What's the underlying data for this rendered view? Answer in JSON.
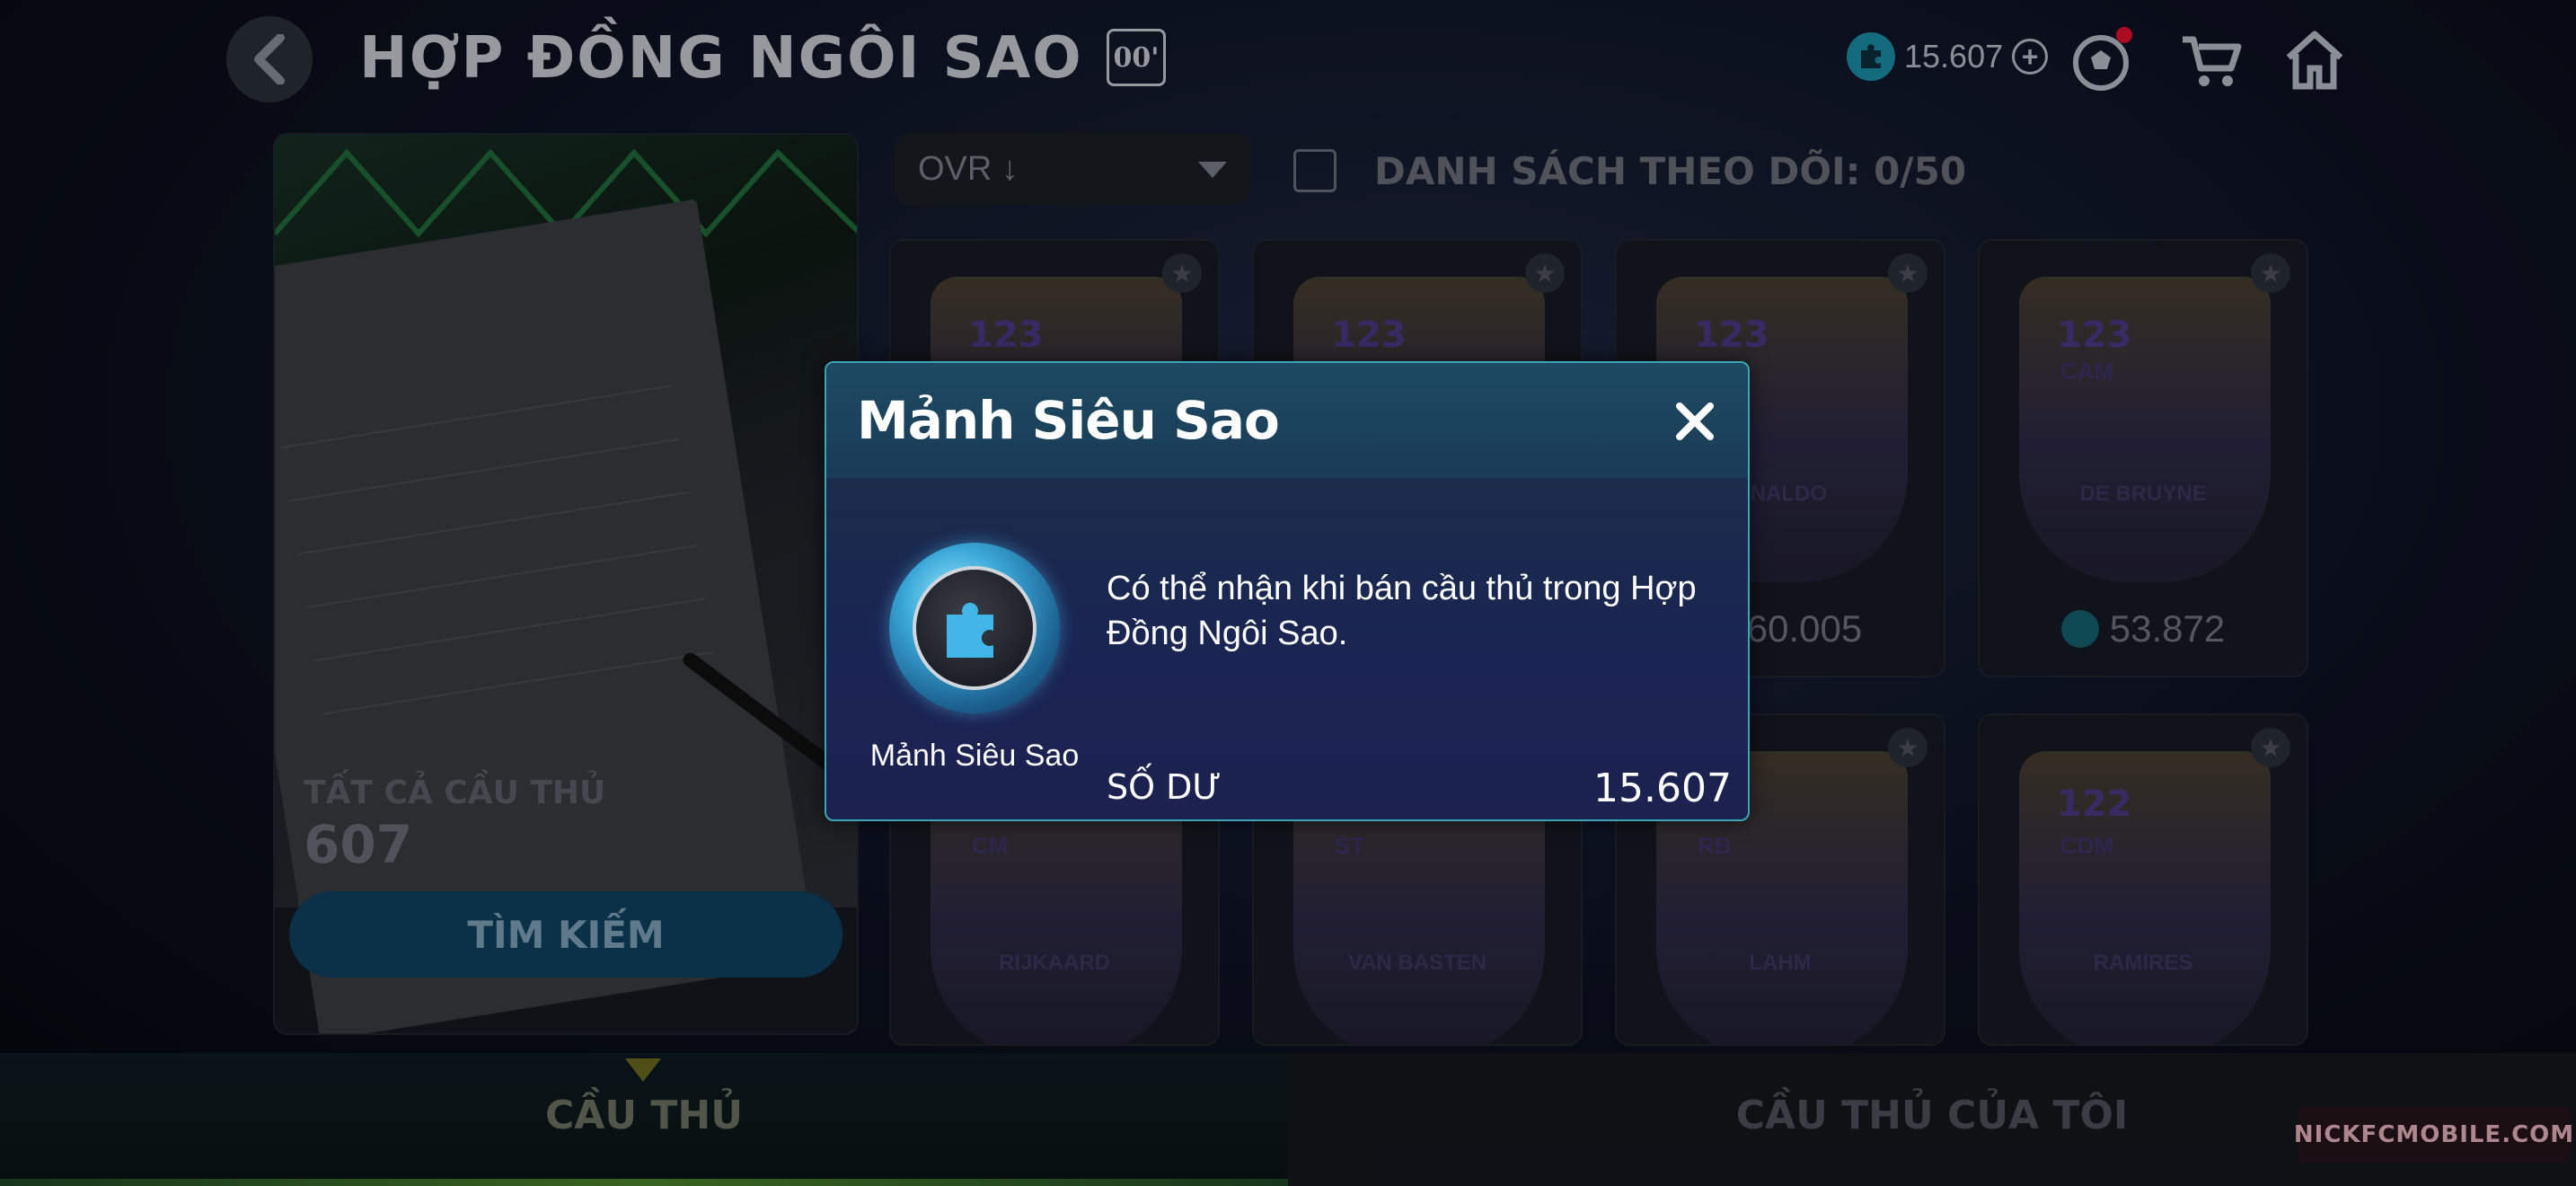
{
  "header": {
    "title": "HỢP ĐỒNG NGÔI SAO",
    "season_badge": "00'",
    "currency_amount": "15.607",
    "icons": [
      "back-icon",
      "plus-icon",
      "ball-icon",
      "cart-icon",
      "home-icon"
    ]
  },
  "left_panel": {
    "all_label": "TẤT CẢ CẦU THỦ",
    "all_count": "607",
    "search_label": "TÌM KIẾM"
  },
  "toolbar": {
    "sort_value": "OVR ↓",
    "watchlist_label": "DANH SÁCH THEO DÕI: 0/50"
  },
  "cards": [
    {
      "ovr": "123",
      "pos": "",
      "name": "",
      "price": ""
    },
    {
      "ovr": "123",
      "pos": "",
      "name": "",
      "price": ""
    },
    {
      "ovr": "123",
      "pos": "",
      "name": "ONALDO",
      "price": "60.005"
    },
    {
      "ovr": "123",
      "pos": "CAM",
      "name": "DE BRUYNE",
      "price": "53.872"
    },
    {
      "ovr": "",
      "pos": "CM",
      "name": "RIJKAARD",
      "price": ""
    },
    {
      "ovr": "",
      "pos": "ST",
      "name": "VAN BASTEN",
      "price": ""
    },
    {
      "ovr": "",
      "pos": "RB",
      "name": "LAHM",
      "price": ""
    },
    {
      "ovr": "122",
      "pos": "CDM",
      "name": "RAMIRES",
      "price": ""
    }
  ],
  "tabs": {
    "left": "CẦU THỦ",
    "right": "CẦU THỦ CỦA TÔI"
  },
  "watermark": "NICKFCMOBILE.COM",
  "modal": {
    "title": "Mảnh Siêu Sao",
    "item_caption": "Mảnh Siêu Sao",
    "description": "Có thể nhận khi bán cầu thủ trong Hợp Đồng Ngôi Sao.",
    "balance_label": "SỐ DƯ",
    "balance_value": "15.607"
  },
  "colors": {
    "modal_border": "#3aa5b4",
    "modal_bg": "#1a2552",
    "accent_token": "#3aa8d8"
  }
}
